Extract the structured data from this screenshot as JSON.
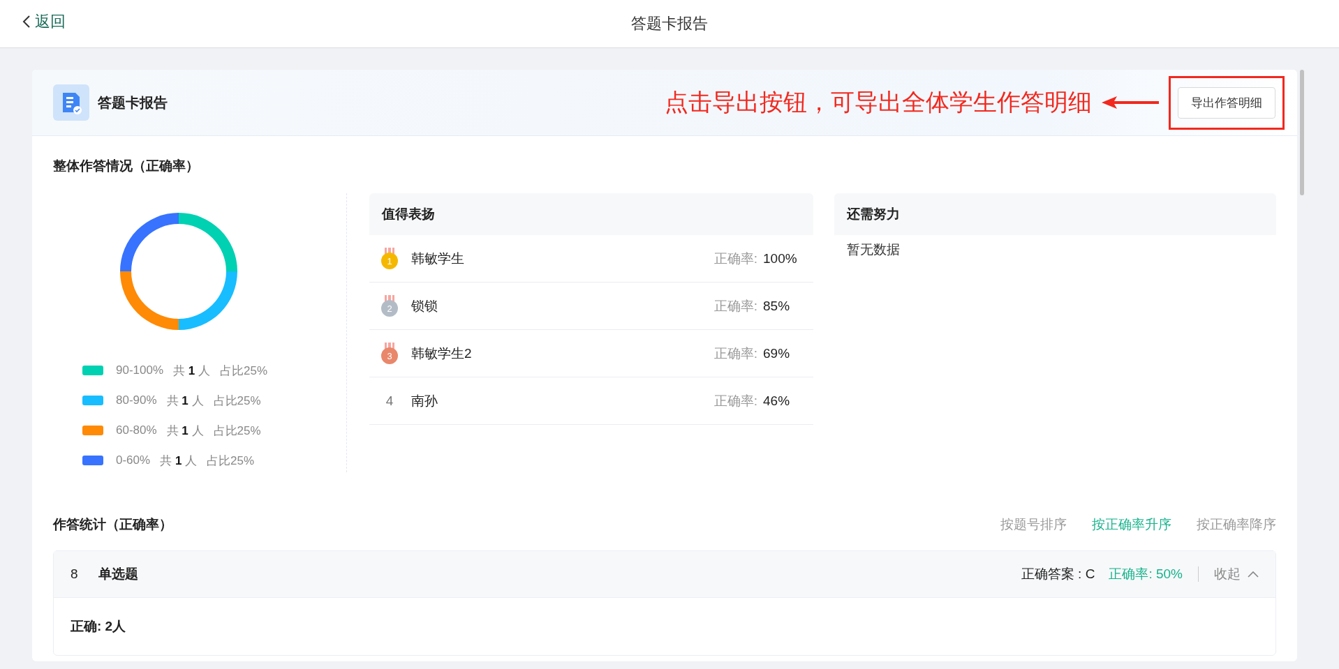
{
  "topbar": {
    "back": "返回",
    "title": "答题卡报告"
  },
  "report": {
    "title": "答题卡报告",
    "annotation": "点击导出按钮，可导出全体学生作答明细",
    "export_button": "导出作答明细"
  },
  "overall": {
    "title": "整体作答情况（正确率）",
    "chart_data": {
      "type": "donut",
      "categories": [
        "90-100%",
        "80-90%",
        "60-80%",
        "0-60%"
      ],
      "values": [
        25,
        25,
        25,
        25
      ]
    },
    "legend": [
      {
        "count": "共 **1** 人",
        "share": "占比25%",
        "color": "#00d1b2"
      },
      {
        "count": "共 **1** 人",
        "share": "占比25%",
        "color": "#18bdff"
      },
      {
        "count": "共 **1** 人",
        "share": "占比25%",
        "color": "#ff8a05"
      },
      {
        "count": "共 **1** 人",
        "share": "占比25%",
        "color": "#3773ff"
      }
    ]
  },
  "praise": {
    "title": "值得表扬",
    "rows": [
      {
        "kind": "medal",
        "rank": "1",
        "color": "#f5b800",
        "name": "韩敏学生",
        "label": "正确率:",
        "value": "100%"
      },
      {
        "kind": "medal",
        "rank": "2",
        "color": "#b3bcc6",
        "name": "锁锁",
        "label": "正确率:",
        "value": "85%"
      },
      {
        "kind": "medal",
        "rank": "3",
        "color": "#e9876b",
        "name": "韩敏学生2",
        "label": "正确率:",
        "value": "69%"
      },
      {
        "kind": "number",
        "rank": "4",
        "name": "南孙",
        "label": "正确率:",
        "value": "46%"
      }
    ]
  },
  "effort": {
    "title": "还需努力",
    "empty": "暂无数据"
  },
  "stats": {
    "title": "作答统计（正确率）",
    "sorts": [
      {
        "label": "按题号排序",
        "selected": false
      },
      {
        "label": "按正确率升序",
        "selected": true
      },
      {
        "label": "按正确率降序",
        "selected": false
      }
    ],
    "question": {
      "number": "8",
      "type": "单选题",
      "answer": "正确答案 : C",
      "rate": "正确率: 50%",
      "toggle": "收起",
      "expanded": true,
      "correct": "正确: 2人"
    }
  }
}
